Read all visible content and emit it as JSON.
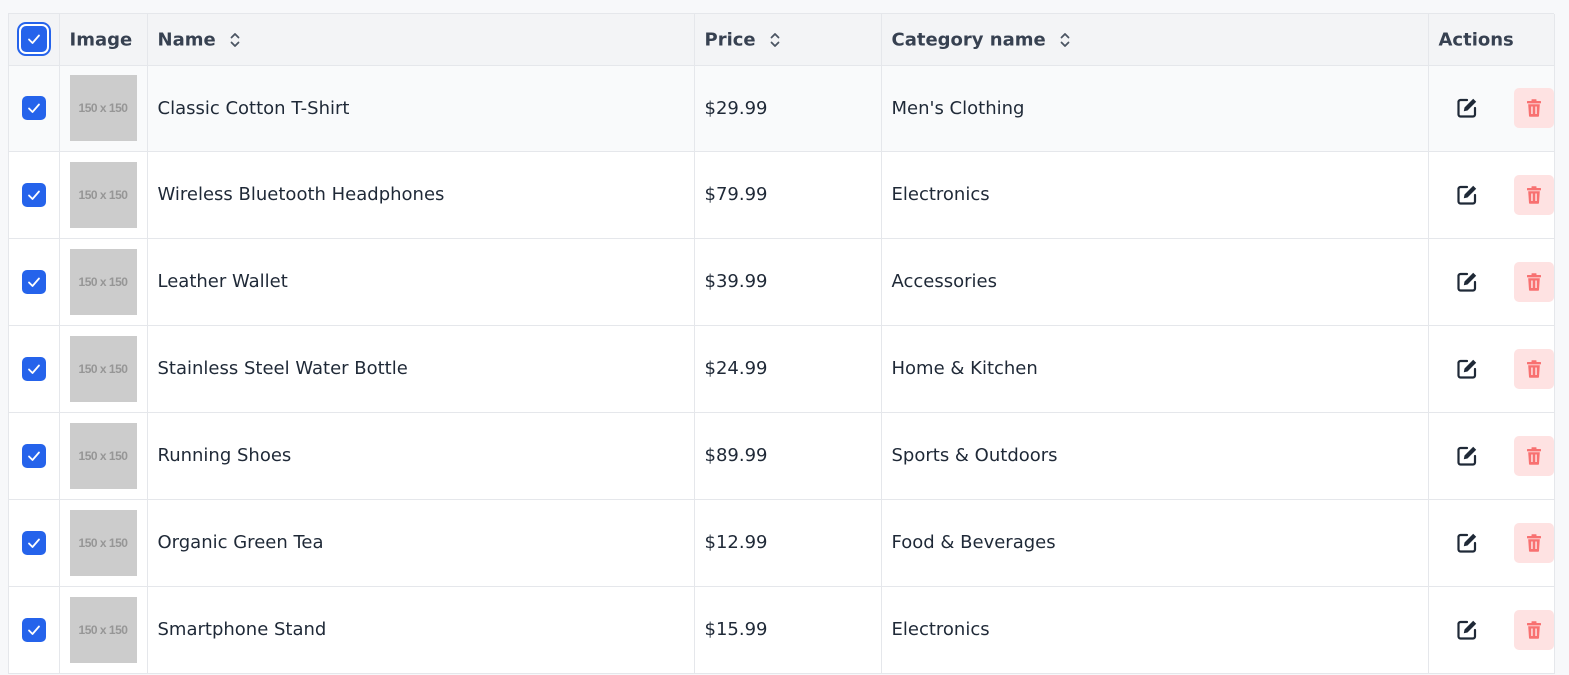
{
  "header": {
    "select_all_checked": true,
    "image": "Image",
    "name": "Name",
    "price": "Price",
    "category": "Category name",
    "actions": "Actions"
  },
  "rows": [
    {
      "checked": true,
      "thumb": "150 x 150",
      "name": "Classic Cotton T-Shirt",
      "price": "$29.99",
      "category": "Men's Clothing"
    },
    {
      "checked": true,
      "thumb": "150 x 150",
      "name": "Wireless Bluetooth Headphones",
      "price": "$79.99",
      "category": "Electronics"
    },
    {
      "checked": true,
      "thumb": "150 x 150",
      "name": "Leather Wallet",
      "price": "$39.99",
      "category": "Accessories"
    },
    {
      "checked": true,
      "thumb": "150 x 150",
      "name": "Stainless Steel Water Bottle",
      "price": "$24.99",
      "category": "Home & Kitchen"
    },
    {
      "checked": true,
      "thumb": "150 x 150",
      "name": "Running Shoes",
      "price": "$89.99",
      "category": "Sports & Outdoors"
    },
    {
      "checked": true,
      "thumb": "150 x 150",
      "name": "Organic Green Tea",
      "price": "$12.99",
      "category": "Food & Beverages"
    },
    {
      "checked": true,
      "thumb": "150 x 150",
      "name": "Smartphone Stand",
      "price": "$15.99",
      "category": "Electronics"
    }
  ],
  "icons": {
    "sort": "sort-icon",
    "edit": "edit-icon",
    "delete": "trash-icon",
    "check": "check-icon"
  },
  "colors": {
    "accent": "#2563eb",
    "delete_bg": "#fee2e2",
    "delete_icon": "#f87171",
    "thumb_bg": "#cccccc"
  }
}
